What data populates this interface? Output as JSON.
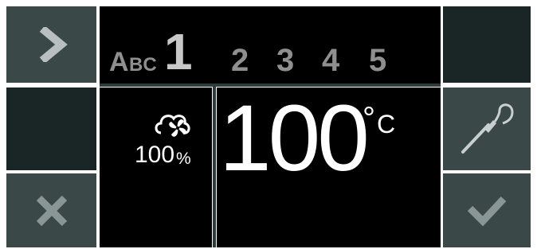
{
  "buttons": {
    "next_icon": "chevron-right-icon",
    "cancel_icon": "close-icon",
    "probe_icon": "core-probe-icon",
    "confirm_icon": "checkmark-icon"
  },
  "steps": {
    "mode_a": "A",
    "mode_bc": "BC",
    "active": "1",
    "items": [
      "2",
      "3",
      "4",
      "5"
    ]
  },
  "fan": {
    "icon": "fan-icon",
    "value": "100",
    "unit": "%"
  },
  "temperature": {
    "value": "100",
    "degree": "°",
    "unit": "C"
  },
  "colors": {
    "button_gray": "#3a4848",
    "button_dark": "#1a2626",
    "background": "#000000",
    "step_inactive": "#8f8f8f",
    "step_active": "#c8c8c8",
    "text": "#ffffff"
  }
}
